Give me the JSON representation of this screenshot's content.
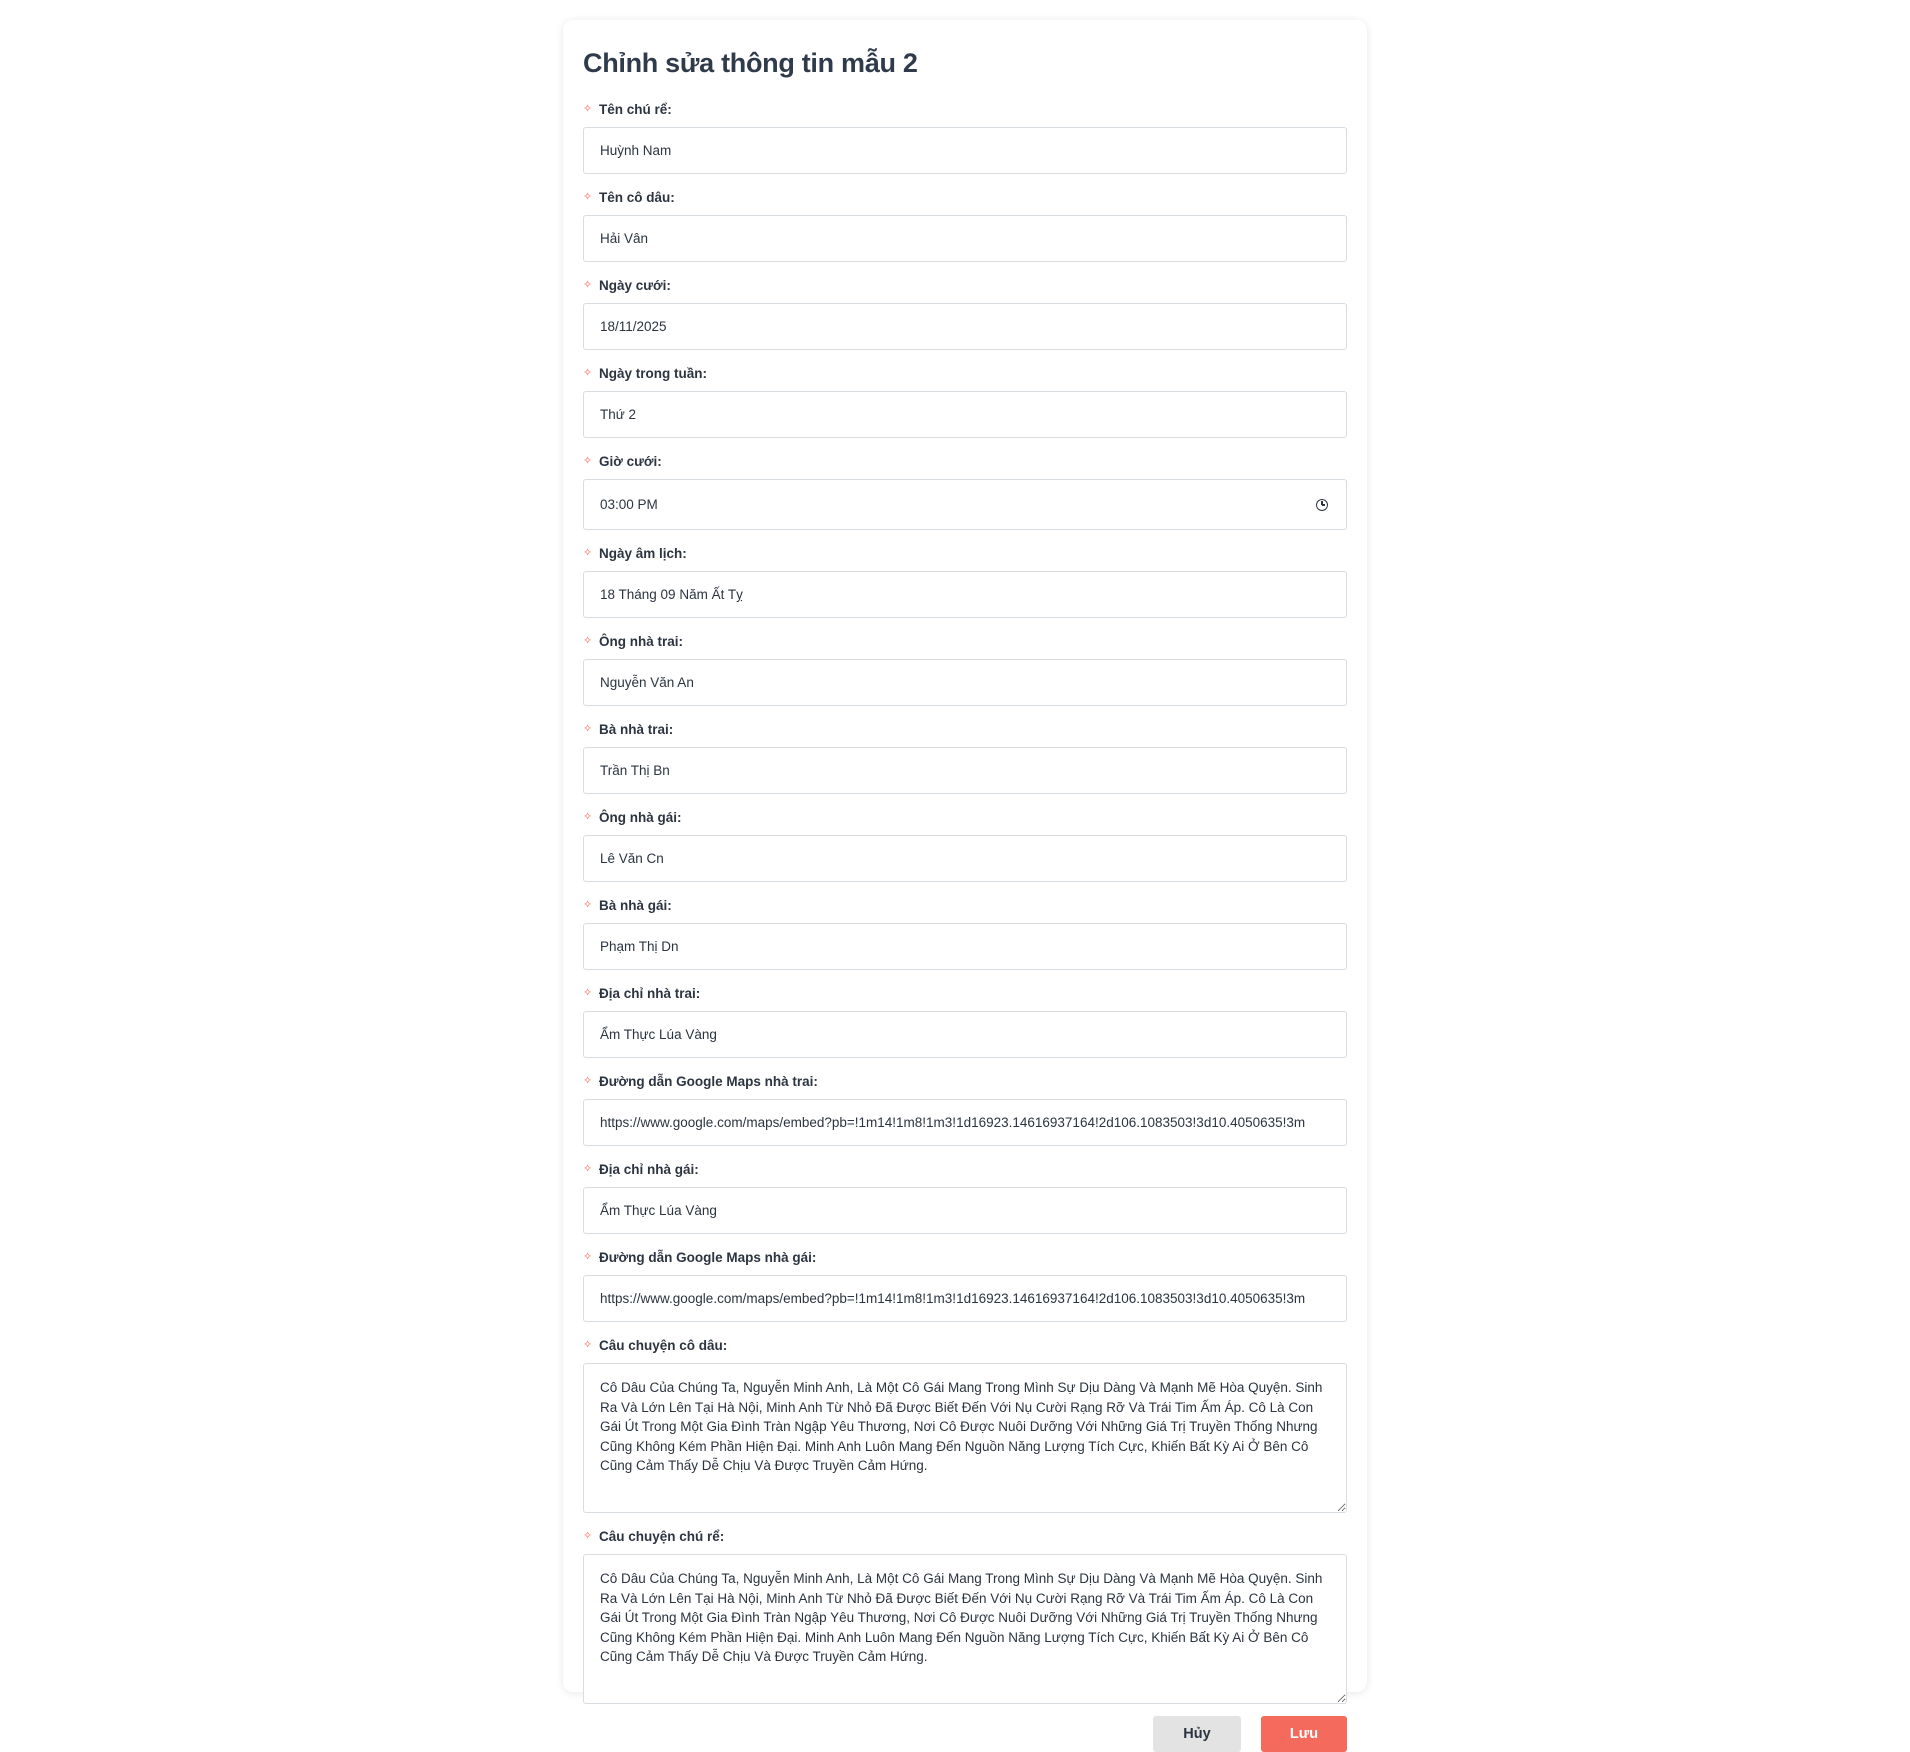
{
  "form": {
    "title": "Chỉnh sửa thông tin mẫu 2",
    "required_marker": "✧",
    "fields": [
      {
        "label": "Tên chú rể:",
        "value": "Huỳnh Nam"
      },
      {
        "label": "Tên cô dâu:",
        "value": "Hải Vân"
      },
      {
        "label": "Ngày cưới:",
        "value": "18/11/2025"
      },
      {
        "label": "Ngày trong tuần:",
        "value": "Thứ 2"
      },
      {
        "label": "Giờ cưới:",
        "value": "03:00 PM"
      },
      {
        "label": "Ngày âm lịch:",
        "value": "18 Tháng 09 Năm Ất Tỵ"
      },
      {
        "label": "Ông nhà trai:",
        "value": "Nguyễn Văn An"
      },
      {
        "label": "Bà nhà trai:",
        "value": "Trần Thị Bn"
      },
      {
        "label": "Ông nhà gái:",
        "value": "Lê Văn Cn"
      },
      {
        "label": "Bà nhà gái:",
        "value": "Phạm Thị Dn"
      },
      {
        "label": "Địa chỉ nhà trai:",
        "value": "Ẩm Thực Lúa Vàng"
      },
      {
        "label": "Đường dẫn Google Maps nhà trai:",
        "value": "https://www.google.com/maps/embed?pb=!1m14!1m8!1m3!1d16923.14616937164!2d106.1083503!3d10.4050635!3m"
      },
      {
        "label": "Địa chỉ nhà gái:",
        "value": "Ẩm Thực Lúa Vàng"
      },
      {
        "label": "Đường dẫn Google Maps nhà gái:",
        "value": "https://www.google.com/maps/embed?pb=!1m14!1m8!1m3!1d16923.14616937164!2d106.1083503!3d10.4050635!3m"
      },
      {
        "label": "Câu chuyện cô dâu:",
        "value": "Cô Dâu Của Chúng Ta, Nguyễn Minh Anh, Là Một Cô Gái Mang Trong Mình Sự Dịu Dàng Và Mạnh Mẽ Hòa Quyện. Sinh Ra Và Lớn Lên Tại Hà Nội, Minh Anh Từ Nhỏ Đã Được Biết Đến Với Nụ Cười Rạng Rỡ Và Trái Tim Ấm Áp. Cô Là Con Gái Út Trong Một Gia Đình Tràn Ngập Yêu Thương, Nơi Cô Được Nuôi Dưỡng Với Những Giá Trị Truyền Thống Nhưng Cũng Không Kém Phần Hiện Đại. Minh Anh Luôn Mang Đến Nguồn Năng Lượng Tích Cực, Khiến Bất Kỳ Ai Ở Bên Cô Cũng Cảm Thấy Dễ Chịu Và Được Truyền Cảm Hứng."
      },
      {
        "label": "Câu chuyện chú rể:",
        "value": "Cô Dâu Của Chúng Ta, Nguyễn Minh Anh, Là Một Cô Gái Mang Trong Mình Sự Dịu Dàng Và Mạnh Mẽ Hòa Quyện. Sinh Ra Và Lớn Lên Tại Hà Nội, Minh Anh Từ Nhỏ Đã Được Biết Đến Với Nụ Cười Rạng Rỡ Và Trái Tim Ấm Áp. Cô Là Con Gái Út Trong Một Gia Đình Tràn Ngập Yêu Thương, Nơi Cô Được Nuôi Dưỡng Với Những Giá Trị Truyền Thống Nhưng Cũng Không Kém Phần Hiện Đại. Minh Anh Luôn Mang Đến Nguồn Năng Lượng Tích Cực, Khiến Bất Kỳ Ai Ở Bên Cô Cũng Cảm Thấy Dễ Chịu Và Được Truyền Cảm Hứng."
      }
    ],
    "buttons": {
      "cancel_label": "Hủy",
      "save_label": "Lưu"
    }
  },
  "colors": {
    "accent": "#f46b5d",
    "cancel_bg": "#e3e3e3",
    "text": "#2b3440"
  },
  "icons": {
    "required": "sparkle-icon",
    "time_picker": "clock-icon"
  }
}
